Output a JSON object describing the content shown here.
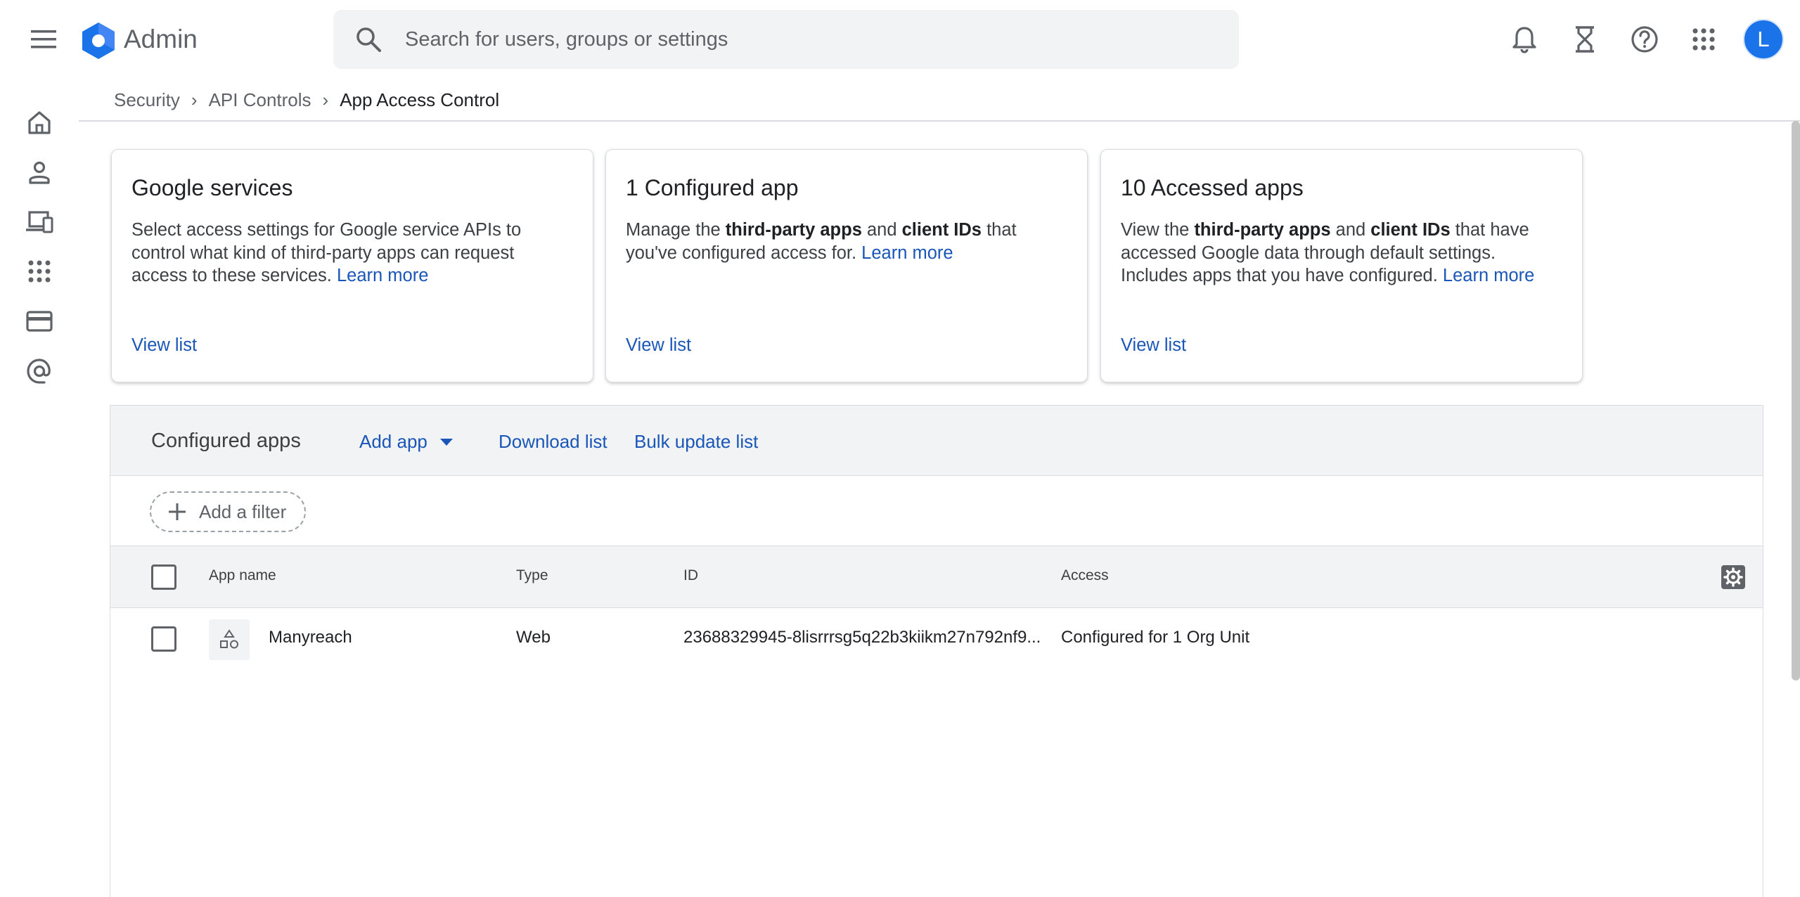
{
  "header": {
    "title": "Admin",
    "search_placeholder": "Search for users, groups or settings",
    "avatar_initial": "L"
  },
  "breadcrumb": {
    "items": [
      "Security",
      "API Controls",
      "App Access Control"
    ]
  },
  "cards": [
    {
      "title": "Google services",
      "desc_parts": [
        "Select access settings for Google service APIs to control what kind of third-party apps can request access to these services."
      ],
      "learn_more": "Learn more",
      "view_list": "View list"
    },
    {
      "title": "1 Configured app",
      "desc_pre": "Manage the ",
      "bold1": "third-party apps",
      "mid": " and ",
      "bold2": "client IDs",
      "desc_post": " that you've configured access for.",
      "learn_more": "Learn more",
      "view_list": "View list"
    },
    {
      "title": "10 Accessed apps",
      "desc_pre": "View the ",
      "bold1": "third-party apps",
      "mid": " and ",
      "bold2": "client IDs",
      "desc_post": " that have accessed Google data through default settings. Includes apps that you have configured.",
      "learn_more": "Learn more",
      "view_list": "View list"
    }
  ],
  "configured_apps": {
    "title": "Configured apps",
    "add_app": "Add app",
    "download_list": "Download list",
    "bulk_update_list": "Bulk update list",
    "add_filter": "Add a filter",
    "columns": {
      "app_name": "App name",
      "type": "Type",
      "id": "ID",
      "access": "Access"
    },
    "rows": [
      {
        "name": "Manyreach",
        "type": "Web",
        "id": "23688329945-8lisrrrsg5q22b3kiikm27n792nf9...",
        "access": "Configured for 1 Org Unit"
      }
    ]
  },
  "colors": {
    "link": "#1a56b8",
    "accent": "#1a73e8",
    "header_bg": "#f1f3f4"
  }
}
